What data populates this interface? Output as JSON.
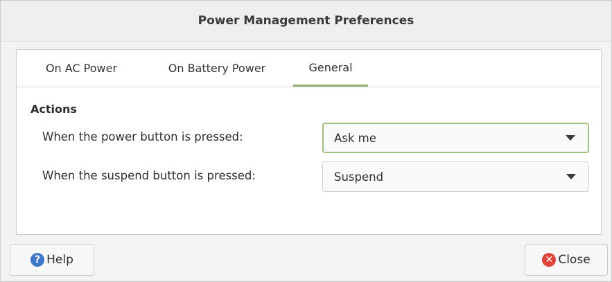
{
  "window": {
    "title": "Power Management Preferences"
  },
  "tabs": [
    {
      "label": "On AC Power",
      "active": false
    },
    {
      "label": "On Battery Power",
      "active": false
    },
    {
      "label": "General",
      "active": true
    }
  ],
  "general": {
    "section_title": "Actions",
    "power_button": {
      "label": "When the power button is pressed:",
      "value": "Ask me"
    },
    "suspend_button": {
      "label": "When the suspend button is pressed:",
      "value": "Suspend"
    }
  },
  "footer": {
    "help_label": "Help",
    "close_label": "Close"
  },
  "colors": {
    "accent": "#8db56a",
    "help_icon": "#3f78c8",
    "close_icon": "#e0433b"
  },
  "icons": {
    "help": "help-icon",
    "close": "close-icon",
    "dropdown": "chevron-down-icon"
  }
}
